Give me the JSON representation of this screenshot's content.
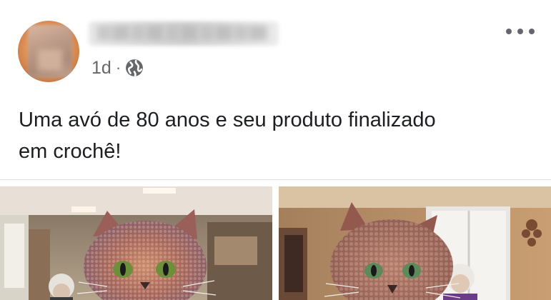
{
  "post": {
    "author_name": "",
    "timestamp": "1d",
    "separator": "·",
    "privacy_icon": "globe-icon",
    "more_icon": "more-options-icon",
    "text_line1": "Uma avó de 80 anos e seu produto finalizado",
    "text_line2": "em crochê!"
  },
  "photos": [
    {
      "name": "photo-crochet-cat-left",
      "colors": {
        "cat": "#b9725a",
        "eyes": "#6e8f3a"
      }
    },
    {
      "name": "photo-crochet-cat-right",
      "colors": {
        "cat": "#a86b5c",
        "eyes": "#5d8a5a"
      }
    }
  ],
  "colors": {
    "text": "#1c1e21",
    "secondary": "#65676b",
    "divider": "#dadde1"
  }
}
